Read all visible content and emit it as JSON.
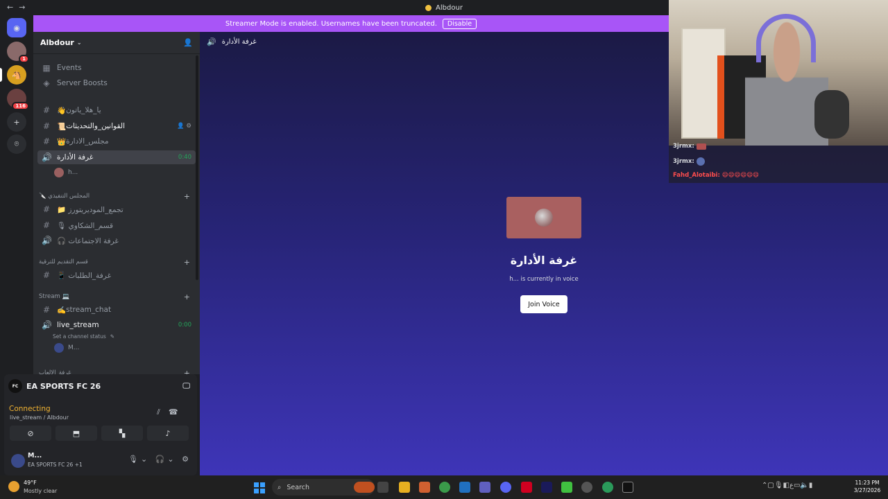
{
  "window": {
    "title": "Albdour",
    "back": "←",
    "forward": "→"
  },
  "banner": {
    "text": "Streamer Mode is enabled. Usernames have been truncated.",
    "button": "Disable"
  },
  "rail": {
    "badges": [
      "1",
      "116"
    ]
  },
  "server": {
    "name": "Albdour"
  },
  "sidebar": {
    "events": "Events",
    "boosts": "Server Boosts",
    "channels": [
      {
        "name": "يا_هلا_ياتون",
        "emoji": "👋"
      },
      {
        "name": "القوانين_والتحديثات",
        "emoji": "📜"
      },
      {
        "name": "مجلس_الادارة",
        "emoji": "👑"
      }
    ],
    "voice_admin": {
      "name": "غرفة الأدارة",
      "time": "0:40",
      "user": "h..."
    },
    "cat1": "🔪 المجلس التنفيذي",
    "cat1_channels": [
      "📁 تجمع_الموديريتورز",
      "🎙 قسم_الشكاوي",
      "🎧 غرفة الاجتماعات"
    ],
    "cat2": "قسم التقديم للترقية",
    "cat2_channels": [
      "📱 غرفة_الطلبات"
    ],
    "cat3": "Stream 💻",
    "stream_chat": "stream_chat",
    "live_stream": "live_stream",
    "live_time": "0:00",
    "status_hint": "Set a channel status",
    "live_user": "M...",
    "cat4": "غرفة_الالعاب"
  },
  "panel": {
    "game": "EA SPORTS FC 26",
    "connecting": "Connecting",
    "conn_sub": "live_stream / Albdour",
    "user": "M...",
    "user_status": "EA SPORTS FC 26 +1"
  },
  "main": {
    "channel": "غرفة الأدارة",
    "title": "غرفة الأدارة",
    "subtitle": "h... is currently in voice",
    "join": "Join Voice"
  },
  "chat": [
    {
      "user": "3jrmx:",
      "color": "#ffffff"
    },
    {
      "user": "3jrmx:",
      "color": "#ffffff"
    },
    {
      "user": "Fahd_Alotaibi:",
      "color": "#ff4d4d",
      "emotes": "😄😄😄😄😄😄"
    }
  ],
  "taskbar": {
    "temp": "49°F",
    "weather": "Mostly clear",
    "search": "Search",
    "time": "11:23 PM",
    "date": "3/27/2026",
    "lang": "ع"
  }
}
